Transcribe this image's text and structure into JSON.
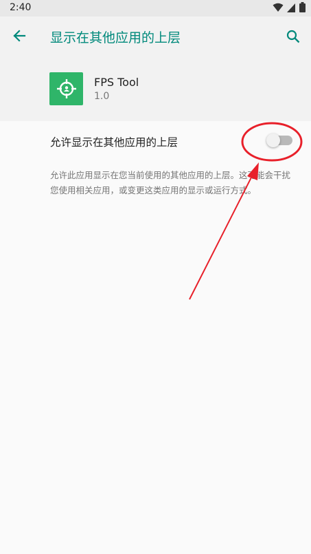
{
  "status_bar": {
    "time": "2:40",
    "icons": [
      "wifi-icon",
      "signal-icon",
      "battery-icon"
    ]
  },
  "header": {
    "title": "显示在其他应用的上层",
    "back_icon": "back-arrow-icon",
    "search_icon": "search-icon"
  },
  "app": {
    "name": "FPS Tool",
    "version": "1.0",
    "icon": "crosshair-icon",
    "icon_color": "#2fb569"
  },
  "setting": {
    "label": "允许显示在其他应用的上层",
    "enabled": false
  },
  "description": "允许此应用显示在您当前使用的其他应用的上层。这可能会干扰您使用相关应用，或变更这类应用的显示或运行方式。",
  "colors": {
    "accent": "#00897b",
    "annotation": "#e8202a"
  }
}
